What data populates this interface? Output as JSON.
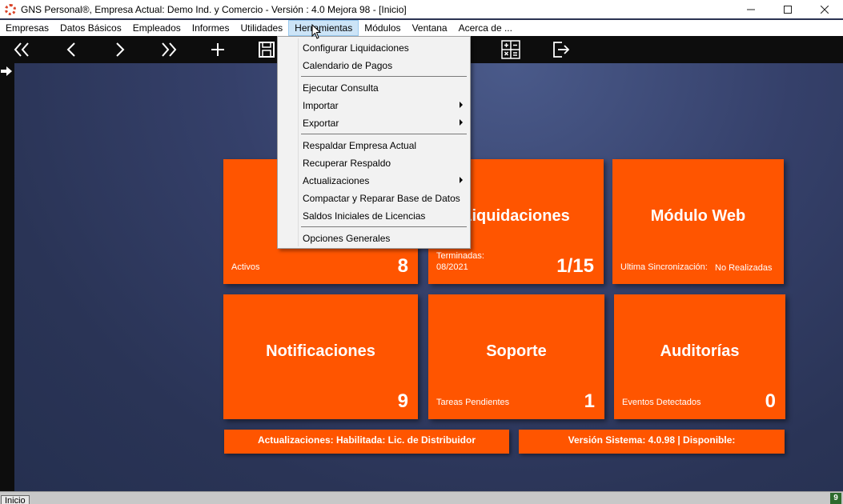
{
  "window": {
    "title": "GNS Personal®, Empresa Actual: Demo Ind. y Comercio - Versión : 4.0 Mejora 98 - [Inicio]",
    "icons": {
      "app": "gns-logo-icon",
      "minimize": "minimize-icon",
      "maximize": "maximize-icon",
      "close": "close-icon"
    }
  },
  "menubar": {
    "items": [
      "Empresas",
      "Datos Básicos",
      "Empleados",
      "Informes",
      "Utilidades",
      "Herramientas",
      "Módulos",
      "Ventana",
      "Acerca de ..."
    ],
    "active": "Herramientas"
  },
  "toolbar": {
    "icons": [
      "first-icon",
      "prev-icon",
      "next-icon",
      "last-icon",
      "add-icon",
      "save-icon",
      "calculator-icon",
      "exit-icon"
    ]
  },
  "dropdown": {
    "items": [
      {
        "label": "Configurar Liquidaciones",
        "submenu": false
      },
      {
        "label": "Calendario de Pagos",
        "submenu": false
      },
      {
        "label": "Ejecutar Consulta",
        "submenu": false
      },
      {
        "label": "Importar",
        "submenu": true
      },
      {
        "label": "Exportar",
        "submenu": true
      },
      {
        "label": "Respaldar Empresa Actual",
        "submenu": false
      },
      {
        "label": "Recuperar Respaldo",
        "submenu": false
      },
      {
        "label": "Actualizaciones",
        "submenu": true
      },
      {
        "label": "Compactar y Reparar  Base de Datos",
        "submenu": false
      },
      {
        "label": "Saldos Iniciales de Licencias",
        "submenu": false
      },
      {
        "label": "Opciones Generales",
        "submenu": false
      }
    ]
  },
  "tiles": {
    "empleados": {
      "sub": "Activos",
      "value": "8"
    },
    "liquidaciones": {
      "title": "Liquidaciones",
      "sub_line1": "Terminadas:",
      "sub_line2": "08/2021",
      "value": "1/15"
    },
    "modulo_web": {
      "title": "Módulo Web",
      "sub": "Ultima Sincronización:",
      "sub2": "No Realizadas"
    },
    "notificaciones": {
      "title": "Notificaciones",
      "value": "9"
    },
    "soporte": {
      "title": "Soporte",
      "sub": "Tareas Pendientes",
      "value": "1"
    },
    "auditorias": {
      "title": "Auditorías",
      "sub": "Eventos Detectados",
      "value": "0"
    }
  },
  "bars": {
    "actualizaciones": "Actualizaciones: Habilitada: Lic. de Distribuidor",
    "version": "Versión Sistema: 4.0.98 | Disponible:"
  },
  "statusbar": {
    "tab": "Inicio",
    "badge": "9"
  },
  "colors": {
    "tile": "#ff5500",
    "toolbar": "#0d0d0d",
    "menu_active": "#cce4f7"
  }
}
